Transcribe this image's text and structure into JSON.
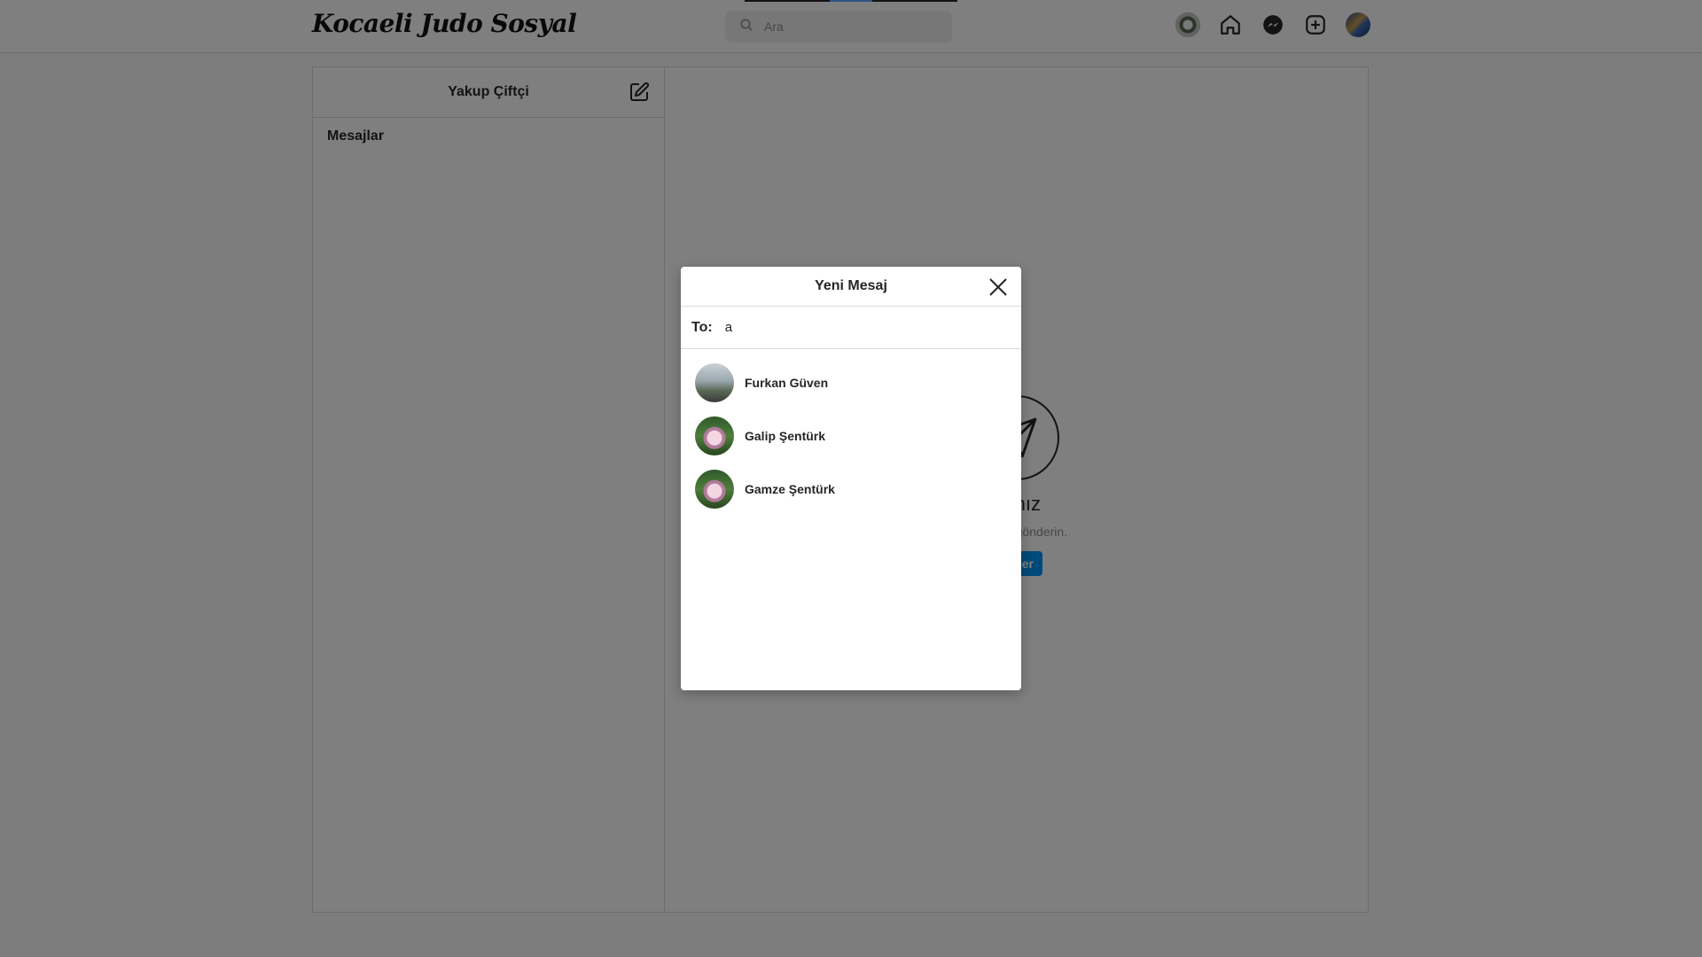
{
  "header": {
    "logo": "Kocaeli Judo Sosyal",
    "search_placeholder": "Ara",
    "icons": [
      "club-avatar",
      "home-icon",
      "messenger-icon",
      "new-post-icon",
      "user-avatar"
    ]
  },
  "inbox": {
    "username": "Yakup Çiftçi",
    "messages_title": "Mesajlar"
  },
  "empty_state": {
    "title_fragment": "arınız",
    "subtitle_fragment": "mesajlar gönderin.",
    "button_fragment": "önder"
  },
  "modal": {
    "title": "Yeni Mesaj",
    "to_label": "To:",
    "to_value": "a",
    "results": [
      {
        "name": "Furkan Güven",
        "avatar": "photo-person-outdoor"
      },
      {
        "name": "Galip Şentürk",
        "avatar": "photo-couple-garden"
      },
      {
        "name": "Gamze Şentürk",
        "avatar": "photo-couple-garden"
      }
    ]
  },
  "colors": {
    "accent": "#0095f6",
    "border": "#dbdbdb",
    "overlay": "rgba(0,0,0,0.5)"
  }
}
